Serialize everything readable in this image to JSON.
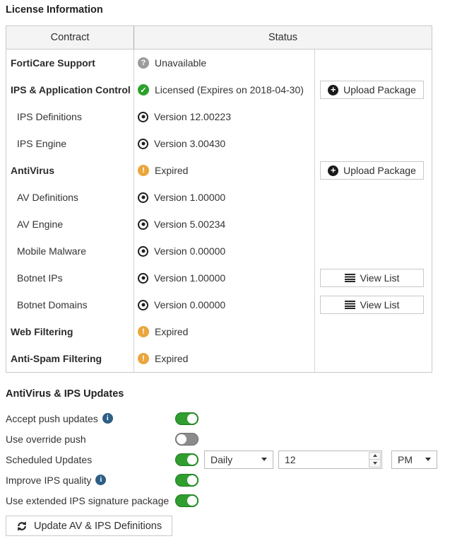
{
  "page": {
    "license_title": "License Information",
    "updates_title": "AntiVirus & IPS Updates"
  },
  "license_table": {
    "headers": {
      "contract": "Contract",
      "status": "Status"
    },
    "rows": [
      {
        "name": "FortiCare Support",
        "style": "section",
        "icon": "question-icon",
        "status": "Unavailable",
        "button": null
      },
      {
        "name": "IPS & Application Control",
        "style": "section",
        "icon": "check-icon",
        "status": "Licensed (Expires on 2018-04-30)",
        "button": {
          "label": "Upload Package",
          "icon": "plus-circle-icon"
        }
      },
      {
        "name": "IPS Definitions",
        "style": "sub",
        "icon": "version-icon",
        "status": "Version 12.00223",
        "button": null
      },
      {
        "name": "IPS Engine",
        "style": "sub",
        "icon": "version-icon",
        "status": "Version 3.00430",
        "button": null
      },
      {
        "name": "AntiVirus",
        "style": "section",
        "icon": "warning-icon",
        "status": "Expired",
        "button": {
          "label": "Upload Package",
          "icon": "plus-circle-icon"
        }
      },
      {
        "name": "AV Definitions",
        "style": "sub",
        "icon": "version-icon",
        "status": "Version 1.00000",
        "button": null
      },
      {
        "name": "AV Engine",
        "style": "sub",
        "icon": "version-icon",
        "status": "Version 5.00234",
        "button": null
      },
      {
        "name": "Mobile Malware",
        "style": "sub",
        "icon": "version-icon",
        "status": "Version 0.00000",
        "button": null
      },
      {
        "name": "Botnet IPs",
        "style": "sub",
        "icon": "version-icon",
        "status": "Version 1.00000",
        "button": {
          "label": "View List",
          "icon": "list-icon"
        }
      },
      {
        "name": "Botnet Domains",
        "style": "sub",
        "icon": "version-icon",
        "status": "Version 0.00000",
        "button": {
          "label": "View List",
          "icon": "list-icon"
        }
      },
      {
        "name": "Web Filtering",
        "style": "section",
        "icon": "warning-icon",
        "status": "Expired",
        "button": null
      },
      {
        "name": "Anti-Spam Filtering",
        "style": "section",
        "icon": "warning-icon",
        "status": "Expired",
        "button": null
      }
    ]
  },
  "updates": {
    "settings": [
      {
        "label": "Accept push updates",
        "info": true,
        "toggle": "on",
        "scheduler": false
      },
      {
        "label": "Use override push",
        "info": false,
        "toggle": "off",
        "scheduler": false
      },
      {
        "label": "Scheduled Updates",
        "info": false,
        "toggle": "on",
        "scheduler": true
      },
      {
        "label": "Improve IPS quality",
        "info": true,
        "toggle": "on",
        "scheduler": false
      },
      {
        "label": "Use extended IPS signature package",
        "info": false,
        "toggle": "on",
        "scheduler": false
      }
    ],
    "scheduler": {
      "frequency": "Daily",
      "hour": "12",
      "meridiem": "PM"
    },
    "update_button_label": "Update AV & IPS Definitions"
  },
  "icons": {
    "question": "?",
    "check": "✓",
    "warning": "!",
    "plus": "+",
    "info": "i"
  },
  "colors": {
    "licensed_green": "#2da12d",
    "expired_orange": "#eaa63c",
    "unavailable_gray": "#9b9b9b",
    "toggle_on_green": "#2f9e2f",
    "toggle_off_gray": "#8b8b8b",
    "info_blue": "#2d5e86",
    "header_bg": "#f4f4f4",
    "border_gray": "#c9c9c9"
  }
}
